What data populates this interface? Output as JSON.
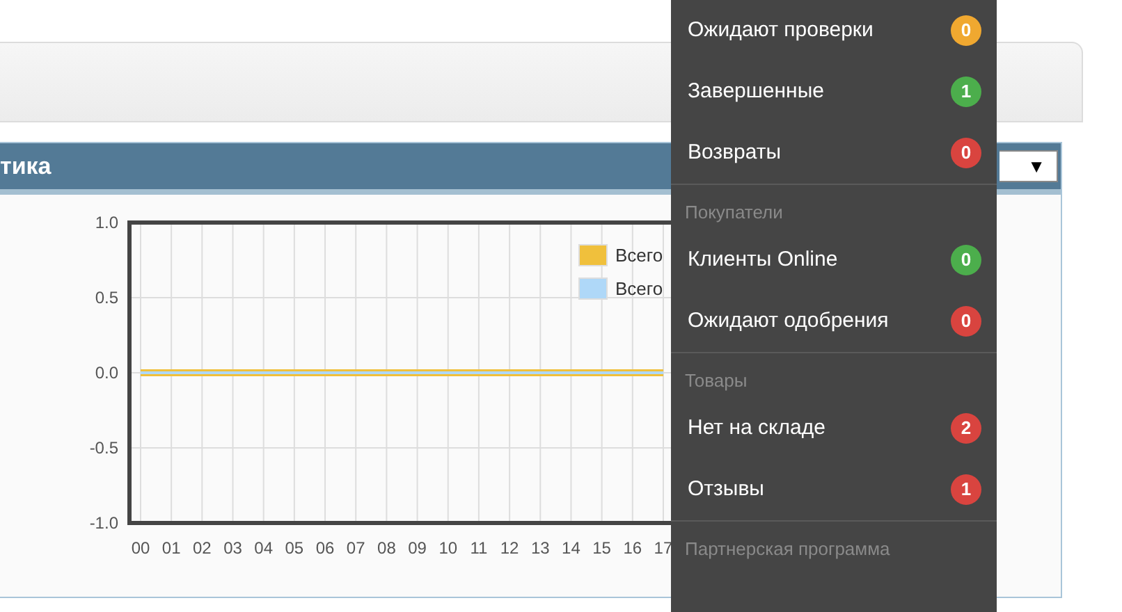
{
  "panel": {
    "title": "тика",
    "range_caret": "▼",
    "chart_data": {
      "type": "line",
      "grid": true,
      "x": [
        "00",
        "01",
        "02",
        "03",
        "04",
        "05",
        "06",
        "07",
        "08",
        "09",
        "10",
        "11",
        "12",
        "13",
        "14",
        "15",
        "16",
        "17"
      ],
      "series": [
        {
          "name": "Всего",
          "color": "#f0c03c",
          "values": [
            0,
            0,
            0,
            0,
            0,
            0,
            0,
            0,
            0,
            0,
            0,
            0,
            0,
            0,
            0,
            0,
            0,
            0
          ]
        },
        {
          "name": "Всего",
          "color": "#afd8f8",
          "values": [
            0,
            0,
            0,
            0,
            0,
            0,
            0,
            0,
            0,
            0,
            0,
            0,
            0,
            0,
            0,
            0,
            0,
            0
          ]
        }
      ],
      "ylim": [
        -1,
        1
      ],
      "yticks": [
        {
          "value": 1,
          "label": "1.0"
        },
        {
          "value": 0.5,
          "label": "0.5"
        },
        {
          "value": 0,
          "label": "0.0"
        },
        {
          "value": -0.5,
          "label": "-0.5"
        },
        {
          "value": -1,
          "label": "-1.0"
        }
      ]
    }
  },
  "menu": {
    "groups": [
      {
        "items": [
          {
            "label": "Ожидают проверки",
            "count": "0",
            "color": "#f0a830"
          },
          {
            "label": "Завершенные",
            "count": "1",
            "color": "#4cae4c"
          },
          {
            "label": "Возвраты",
            "count": "0",
            "color": "#d9443f"
          }
        ]
      },
      {
        "header": "Покупатели",
        "items": [
          {
            "label": "Клиенты Online",
            "count": "0",
            "color": "#4cae4c"
          },
          {
            "label": "Ожидают одобрения",
            "count": "0",
            "color": "#d9443f"
          }
        ]
      },
      {
        "header": "Товары",
        "items": [
          {
            "label": "Нет на складе",
            "count": "2",
            "color": "#d9443f"
          },
          {
            "label": "Отзывы",
            "count": "1",
            "color": "#d9443f"
          }
        ]
      },
      {
        "header": "Партнерская программа"
      }
    ]
  }
}
